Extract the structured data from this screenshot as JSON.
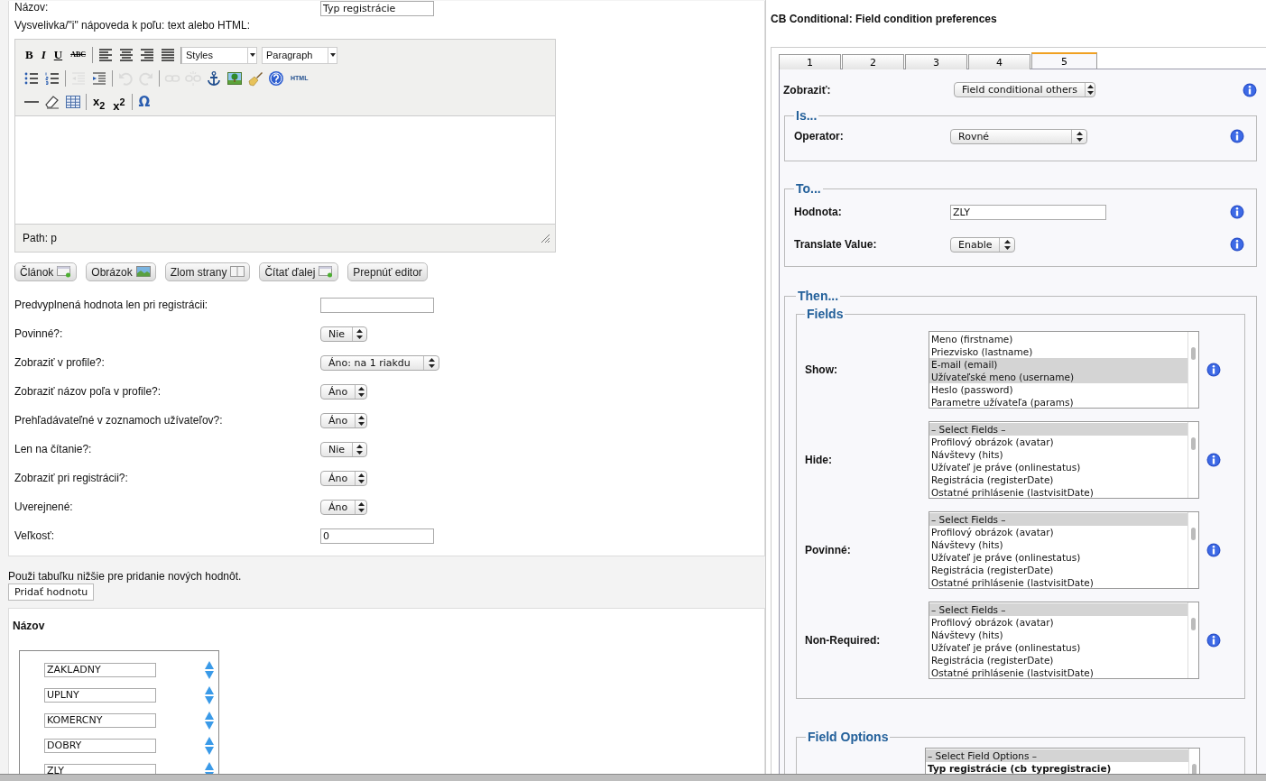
{
  "top_field": {
    "label": "Názov:",
    "value": "Typ registrácie"
  },
  "description_label": "Vysvelivka/\"i\" nápoveda k poľu: text alebo HTML:",
  "editor": {
    "toolbar": [
      {
        "groups": [
          [
            {
              "kind": "bold",
              "label": "B",
              "disabled": false
            },
            {
              "kind": "italic",
              "label": "I",
              "disabled": false
            },
            {
              "kind": "underline",
              "label": "U",
              "disabled": false
            },
            {
              "kind": "strike",
              "label": "ABC",
              "disabled": false
            }
          ],
          [
            {
              "kind": "alignleft",
              "disabled": false
            },
            {
              "kind": "aligncenter",
              "disabled": false
            },
            {
              "kind": "alignright",
              "disabled": false
            },
            {
              "kind": "justify",
              "disabled": false
            }
          ],
          [
            {
              "kind": "select",
              "label": "Styles",
              "disabled": false
            },
            {
              "kind": "select",
              "label": "Paragraph",
              "disabled": false
            }
          ]
        ]
      },
      {
        "groups": [
          [
            {
              "kind": "bullets",
              "disabled": false
            },
            {
              "kind": "numbers",
              "disabled": false
            }
          ],
          [
            {
              "kind": "outdent",
              "disabled": true
            },
            {
              "kind": "indent",
              "disabled": false
            }
          ],
          [
            {
              "kind": "undo",
              "disabled": true
            },
            {
              "kind": "redo",
              "disabled": true
            }
          ],
          [
            {
              "kind": "link",
              "disabled": true
            },
            {
              "kind": "unlink",
              "disabled": true
            },
            {
              "kind": "anchor",
              "disabled": false
            },
            {
              "kind": "image",
              "disabled": false
            },
            {
              "kind": "brush",
              "disabled": false
            },
            {
              "kind": "help",
              "disabled": false
            },
            {
              "kind": "small",
              "label": "HTML",
              "disabled": false
            }
          ]
        ]
      },
      {
        "groups": [
          [
            {
              "kind": "rule",
              "disabled": false
            },
            {
              "kind": "eraser",
              "disabled": false
            },
            {
              "kind": "table",
              "disabled": false
            }
          ],
          [
            {
              "kind": "script",
              "label": "x$_{2}$",
              "disabled": false
            },
            {
              "kind": "script",
              "label": "x$^{2}$",
              "disabled": false
            }
          ],
          [
            {
              "kind": "omega",
              "label": "Ω",
              "disabled": false
            }
          ]
        ]
      }
    ],
    "path": "Path: p",
    "buttons": [
      {
        "label": "Článok",
        "kind": "document"
      },
      {
        "label": "Obrázok",
        "kind": "image"
      },
      {
        "label": "Zlom strany",
        "kind": "pagebreak"
      },
      {
        "label": "Čítať ďalej",
        "kind": "document"
      },
      {
        "label": "Prepnúť editor",
        "kind": "plain"
      }
    ]
  },
  "form_rows": [
    {
      "label": "Predvyplnená hodnota len pri registrácii:",
      "kind": "input",
      "value": ""
    },
    {
      "label": "Povinné?:",
      "kind": "select",
      "value": "Nie"
    },
    {
      "label": "Zobraziť v profile?:",
      "kind": "select",
      "value": "Áno: na 1 riakdu",
      "wide": true
    },
    {
      "label": "Zobraziť názov poľa v profile?:",
      "kind": "select",
      "value": "Áno"
    },
    {
      "label": "Prehľadávateľné v zoznamoch užívateľov?:",
      "kind": "select",
      "value": "Áno"
    },
    {
      "label": "Len na čítanie?:",
      "kind": "select",
      "value": "Nie"
    },
    {
      "label": "Zobraziť pri registrácii?:",
      "kind": "select",
      "value": "Áno"
    },
    {
      "label": "Uverejnené:",
      "kind": "select",
      "value": "Áno"
    },
    {
      "label": "Veľkosť:",
      "kind": "input",
      "value": "0"
    }
  ],
  "values_hint": "Použi tabuľku nižšie pre pridanie nových hodnôt.",
  "add_value_button": "Pridať hodnotu",
  "values": {
    "heading": "Názov",
    "items": [
      "ZAKLADNY",
      "UPLNY",
      "KOMERCNY",
      "DOBRY",
      "ZLY"
    ]
  },
  "conditional": {
    "title": "CB Conditional: Field condition preferences",
    "tabs": [
      {
        "label": "1",
        "selected": false
      },
      {
        "label": "2",
        "selected": false
      },
      {
        "label": "3",
        "selected": false
      },
      {
        "label": "4",
        "selected": false
      },
      {
        "label": "5",
        "selected": true
      }
    ],
    "display": {
      "label": "Zobraziť:",
      "value": "Field conditional others"
    },
    "is": {
      "legend": "Is...",
      "label": "Operator:",
      "value": "Rovné"
    },
    "to": {
      "legend": "To...",
      "value_label": "Hodnota:",
      "value": "ZLY",
      "translate_label": "Translate Value:",
      "translate": "Enable"
    },
    "then": {
      "legend": "Then...",
      "fields_legend": "Fields",
      "lists": [
        {
          "label": "Show:",
          "options": [
            {
              "text": "Meno (firstname)",
              "selected": false
            },
            {
              "text": "Priezvisko (lastname)",
              "selected": false
            },
            {
              "text": "E-mail (email)",
              "selected": true
            },
            {
              "text": "Užívateľské meno (username)",
              "selected": true
            },
            {
              "text": "Heslo (password)",
              "selected": false
            },
            {
              "text": "Parametre užívateľa (params)",
              "selected": false
            }
          ]
        },
        {
          "label": "Hide:",
          "options": [
            {
              "text": "– Select Fields –",
              "selected": true
            },
            {
              "text": "Profilový obrázok (avatar)",
              "selected": false
            },
            {
              "text": "Návštevy (hits)",
              "selected": false
            },
            {
              "text": "Užívateľ je práve (onlinestatus)",
              "selected": false
            },
            {
              "text": "Registrácia (registerDate)",
              "selected": false
            },
            {
              "text": "Ostatné prihlásenie (lastvisitDate)",
              "selected": false
            }
          ]
        },
        {
          "label": "Povinné:",
          "options": [
            {
              "text": "– Select Fields –",
              "selected": true
            },
            {
              "text": "Profilový obrázok (avatar)",
              "selected": false
            },
            {
              "text": "Návštevy (hits)",
              "selected": false
            },
            {
              "text": "Užívateľ je práve (onlinestatus)",
              "selected": false
            },
            {
              "text": "Registrácia (registerDate)",
              "selected": false
            },
            {
              "text": "Ostatné prihlásenie (lastvisitDate)",
              "selected": false
            }
          ]
        },
        {
          "label": "Non-Required:",
          "options": [
            {
              "text": "– Select Fields –",
              "selected": true
            },
            {
              "text": "Profilový obrázok (avatar)",
              "selected": false
            },
            {
              "text": "Návštevy (hits)",
              "selected": false
            },
            {
              "text": "Užívateľ je práve (onlinestatus)",
              "selected": false
            },
            {
              "text": "Registrácia (registerDate)",
              "selected": false
            },
            {
              "text": "Ostatné prihlásenie (lastvisitDate)",
              "selected": false
            }
          ]
        }
      ],
      "options_legend": "Field Options",
      "field_options": [
        {
          "text": "– Select Field Options –",
          "kind": "option",
          "selected": true
        },
        {
          "text": "Typ registrácie (cb_typregistracie)",
          "kind": "group",
          "selected": false
        }
      ]
    }
  }
}
